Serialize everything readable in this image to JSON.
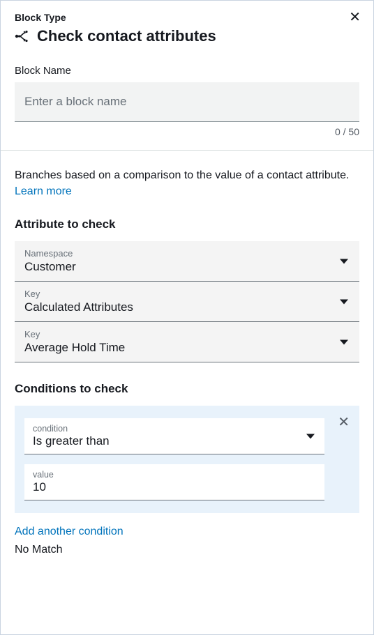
{
  "header": {
    "block_type_label": "Block Type",
    "page_title": "Check contact attributes",
    "block_name_label": "Block Name",
    "block_name_placeholder": "Enter a block name",
    "block_name_value": "",
    "char_count": "0 / 50"
  },
  "description": {
    "text": "Branches based on a comparison to the value of a contact attribute. ",
    "link_text": "Learn more"
  },
  "attribute_section": {
    "heading": "Attribute to check",
    "fields": [
      {
        "label": "Namespace",
        "value": "Customer"
      },
      {
        "label": "Key",
        "value": "Calculated Attributes"
      },
      {
        "label": "Key",
        "value": "Average Hold Time"
      }
    ]
  },
  "conditions_section": {
    "heading": "Conditions to check",
    "condition": {
      "condition_label": "condition",
      "condition_value": "Is greater than",
      "value_label": "value",
      "value_value": "10"
    },
    "add_link": "Add another condition",
    "no_match": "No Match"
  }
}
